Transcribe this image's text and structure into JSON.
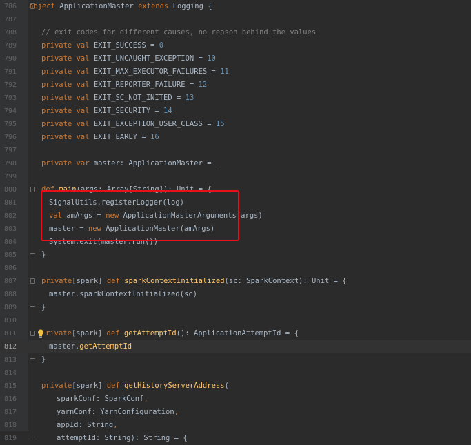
{
  "lines": [
    {
      "num": "786",
      "indent": 42,
      "fold": "start",
      "tokens": [
        {
          "t": "object ",
          "c": "kw"
        },
        {
          "t": "ApplicationMaster ",
          "c": "pl"
        },
        {
          "t": "extends ",
          "c": "kw"
        },
        {
          "t": "Logging {",
          "c": "pl"
        }
      ]
    },
    {
      "num": "787",
      "indent": 60,
      "tokens": []
    },
    {
      "num": "788",
      "indent": 60,
      "tokens": [
        {
          "t": "// exit codes for different causes, no reason behind the values",
          "c": "cm"
        }
      ]
    },
    {
      "num": "789",
      "indent": 60,
      "tokens": [
        {
          "t": "private val ",
          "c": "kw"
        },
        {
          "t": "EXIT_SUCCESS = ",
          "c": "pl"
        },
        {
          "t": "0",
          "c": "num"
        }
      ]
    },
    {
      "num": "790",
      "indent": 60,
      "tokens": [
        {
          "t": "private val ",
          "c": "kw"
        },
        {
          "t": "EXIT_UNCAUGHT_EXCEPTION = ",
          "c": "pl"
        },
        {
          "t": "10",
          "c": "num"
        }
      ]
    },
    {
      "num": "791",
      "indent": 60,
      "tokens": [
        {
          "t": "private val ",
          "c": "kw"
        },
        {
          "t": "EXIT_MAX_EXECUTOR_FAILURES = ",
          "c": "pl"
        },
        {
          "t": "11",
          "c": "num"
        }
      ]
    },
    {
      "num": "792",
      "indent": 60,
      "tokens": [
        {
          "t": "private val ",
          "c": "kw"
        },
        {
          "t": "EXIT_REPORTER_FAILURE = ",
          "c": "pl"
        },
        {
          "t": "12",
          "c": "num"
        }
      ]
    },
    {
      "num": "793",
      "indent": 60,
      "tokens": [
        {
          "t": "private val ",
          "c": "kw"
        },
        {
          "t": "EXIT_SC_NOT_INITED = ",
          "c": "pl"
        },
        {
          "t": "13",
          "c": "num"
        }
      ]
    },
    {
      "num": "794",
      "indent": 60,
      "tokens": [
        {
          "t": "private val ",
          "c": "kw"
        },
        {
          "t": "EXIT_SECURITY = ",
          "c": "pl"
        },
        {
          "t": "14",
          "c": "num"
        }
      ]
    },
    {
      "num": "795",
      "indent": 60,
      "tokens": [
        {
          "t": "private val ",
          "c": "kw"
        },
        {
          "t": "EXIT_EXCEPTION_USER_CLASS = ",
          "c": "pl"
        },
        {
          "t": "15",
          "c": "num"
        }
      ]
    },
    {
      "num": "796",
      "indent": 60,
      "tokens": [
        {
          "t": "private val ",
          "c": "kw"
        },
        {
          "t": "EXIT_EARLY = ",
          "c": "pl"
        },
        {
          "t": "16",
          "c": "num"
        }
      ]
    },
    {
      "num": "797",
      "indent": 60,
      "tokens": []
    },
    {
      "num": "798",
      "indent": 60,
      "tokens": [
        {
          "t": "private var ",
          "c": "kw"
        },
        {
          "t": "master: ApplicationMaster = _",
          "c": "pl"
        }
      ]
    },
    {
      "num": "799",
      "indent": 60,
      "tokens": []
    },
    {
      "num": "800",
      "indent": 60,
      "fold": "start",
      "tokens": [
        {
          "t": "def ",
          "c": "kw"
        },
        {
          "t": "main",
          "c": "fn"
        },
        {
          "t": "(args: Array[String]): Unit = {",
          "c": "pl"
        }
      ]
    },
    {
      "num": "801",
      "indent": 71,
      "tokens": [
        {
          "t": "SignalUtils.registerLogger(log)",
          "c": "pl"
        }
      ]
    },
    {
      "num": "802",
      "indent": 71,
      "tokens": [
        {
          "t": "val ",
          "c": "kw"
        },
        {
          "t": "amArgs = ",
          "c": "pl"
        },
        {
          "t": "new ",
          "c": "kw"
        },
        {
          "t": "ApplicationMasterArguments(args)",
          "c": "pl"
        }
      ]
    },
    {
      "num": "803",
      "indent": 71,
      "tokens": [
        {
          "t": "master = ",
          "c": "pl"
        },
        {
          "t": "new ",
          "c": "kw"
        },
        {
          "t": "ApplicationMaster(amArgs)",
          "c": "pl"
        }
      ]
    },
    {
      "num": "804",
      "indent": 71,
      "tokens": [
        {
          "t": "System.exit(master.run())",
          "c": "pl"
        }
      ]
    },
    {
      "num": "805",
      "indent": 60,
      "fold": "end",
      "tokens": [
        {
          "t": "}",
          "c": "pl"
        }
      ]
    },
    {
      "num": "806",
      "indent": 60,
      "tokens": []
    },
    {
      "num": "807",
      "indent": 60,
      "fold": "start",
      "tokens": [
        {
          "t": "private",
          "c": "kw"
        },
        {
          "t": "[spark] ",
          "c": "pl"
        },
        {
          "t": "def ",
          "c": "kw"
        },
        {
          "t": "sparkContextInitialized",
          "c": "fn"
        },
        {
          "t": "(sc: SparkContext): Unit = {",
          "c": "pl"
        }
      ]
    },
    {
      "num": "808",
      "indent": 71,
      "tokens": [
        {
          "t": "master.sparkContextInitialized(sc)",
          "c": "pl"
        }
      ]
    },
    {
      "num": "809",
      "indent": 60,
      "fold": "end",
      "tokens": [
        {
          "t": "}",
          "c": "pl"
        }
      ]
    },
    {
      "num": "810",
      "indent": 60,
      "tokens": []
    },
    {
      "num": "811",
      "indent": 66,
      "fold": "start",
      "bulb": true,
      "tokens": [
        {
          "t": "rivate",
          "c": "kw"
        },
        {
          "t": "[spark] ",
          "c": "pl"
        },
        {
          "t": "def ",
          "c": "kw"
        },
        {
          "t": "getAttemptId",
          "c": "fn"
        },
        {
          "t": "(): ApplicationAttemptId = {",
          "c": "pl"
        }
      ]
    },
    {
      "num": "812",
      "indent": 71,
      "current": true,
      "tokens": [
        {
          "t": "master.",
          "c": "pl"
        },
        {
          "t": "getAttemptId",
          "c": "fn"
        }
      ]
    },
    {
      "num": "813",
      "indent": 60,
      "fold": "end",
      "tokens": [
        {
          "t": "}",
          "c": "pl"
        }
      ]
    },
    {
      "num": "814",
      "indent": 60,
      "tokens": []
    },
    {
      "num": "815",
      "indent": 60,
      "tokens": [
        {
          "t": "private",
          "c": "kw"
        },
        {
          "t": "[spark] ",
          "c": "pl"
        },
        {
          "t": "def ",
          "c": "kw"
        },
        {
          "t": "getHistoryServerAddress",
          "c": "fn"
        },
        {
          "t": "(",
          "c": "pl"
        }
      ]
    },
    {
      "num": "816",
      "indent": 82,
      "tokens": [
        {
          "t": "sparkConf: SparkConf",
          "c": "pl"
        },
        {
          "t": ",",
          "c": "kw"
        }
      ]
    },
    {
      "num": "817",
      "indent": 82,
      "tokens": [
        {
          "t": "yarnConf: YarnConfiguration",
          "c": "pl"
        },
        {
          "t": ",",
          "c": "kw"
        }
      ]
    },
    {
      "num": "818",
      "indent": 82,
      "tokens": [
        {
          "t": "appId: String",
          "c": "pl"
        },
        {
          "t": ",",
          "c": "kw"
        }
      ]
    },
    {
      "num": "819",
      "indent": 82,
      "fold": "end",
      "tokens": [
        {
          "t": "attemptId: String): String = {",
          "c": "pl"
        }
      ]
    }
  ],
  "colors": {
    "background": "#2b2b2b",
    "gutter": "#313335",
    "keyword": "#cc7832",
    "plain": "#a9b7c6",
    "number": "#6897bb",
    "comment": "#808080",
    "function": "#ffc66d",
    "highlight_border": "#e8101a"
  },
  "icons": {
    "intention_bulb": "lightbulb-icon",
    "fold_marker": "fold-icon"
  }
}
